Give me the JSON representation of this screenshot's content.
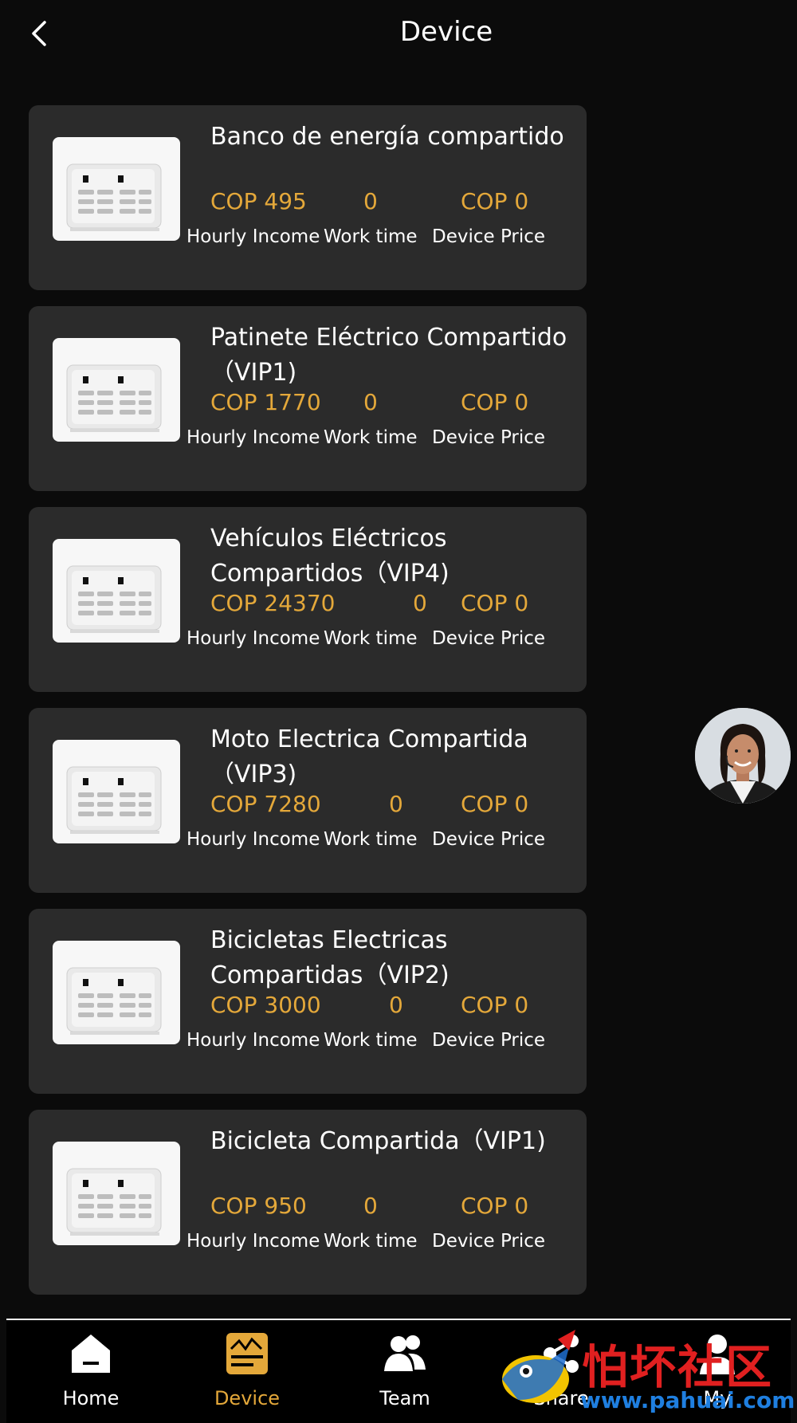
{
  "header": {
    "title": "Device"
  },
  "devices": [
    {
      "name": "Banco de energía compartido",
      "hourly_income": "COP 495",
      "work_time": "0",
      "device_price": "COP 0"
    },
    {
      "name": "Patinete Eléctrico Compartido（VIP1)",
      "hourly_income": "COP 1770",
      "work_time": "0",
      "device_price": "COP 0"
    },
    {
      "name": "Vehículos Eléctricos Compartidos（VIP4)",
      "hourly_income": "COP 24370",
      "work_time": "0",
      "device_price": "COP 0"
    },
    {
      "name": "Moto Electrica Compartida（VIP3)",
      "hourly_income": "COP 7280",
      "work_time": "0",
      "device_price": "COP 0"
    },
    {
      "name": "Bicicletas Electricas Compartidas（VIP2)",
      "hourly_income": "COP 3000",
      "work_time": "0",
      "device_price": "COP 0"
    },
    {
      "name": "Bicicleta Compartida（VIP1)",
      "hourly_income": "COP 950",
      "work_time": "0",
      "device_price": "COP 0"
    }
  ],
  "labels": {
    "hourly_income": "Hourly Income",
    "work_time": "Work time",
    "device_price": "Device Price"
  },
  "tabbar": [
    {
      "label": "Home",
      "icon": "home-icon"
    },
    {
      "label": "Device",
      "icon": "device-icon",
      "active": true
    },
    {
      "label": "Team",
      "icon": "team-icon"
    },
    {
      "label": "Share",
      "icon": "share-icon"
    },
    {
      "label": "My",
      "icon": "user-icon"
    }
  ],
  "watermark": {
    "text": "怕坏社区",
    "url": "www.pahuai.com"
  },
  "colors": {
    "accent": "#e4a83a",
    "card": "#2b2b2b",
    "background": "#0b0b0b"
  }
}
